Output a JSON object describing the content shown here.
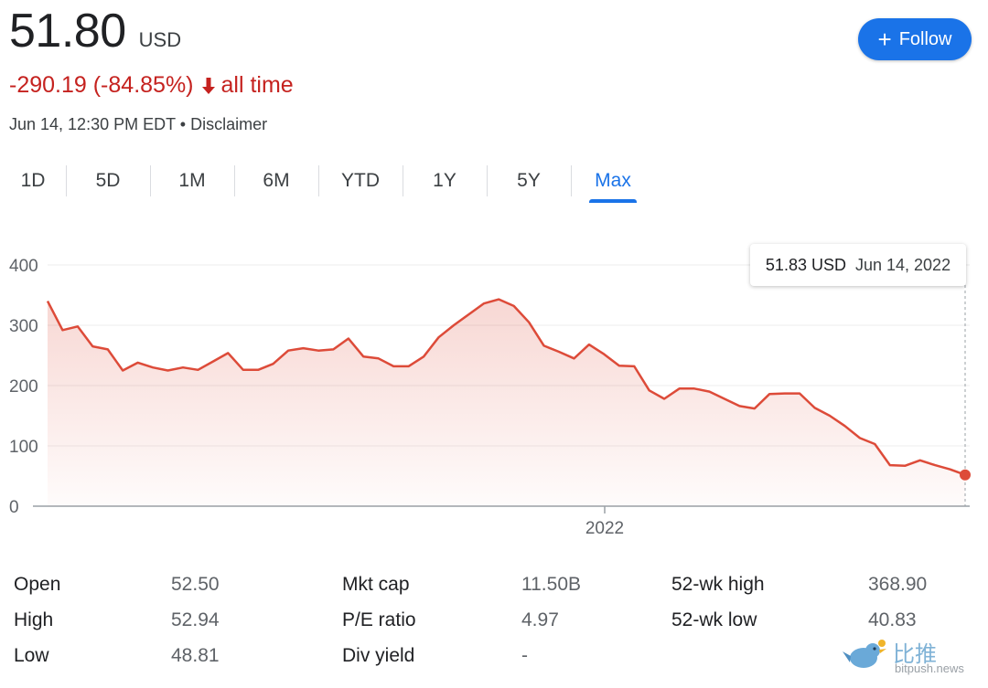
{
  "header": {
    "price": "51.80",
    "currency": "USD",
    "change": "-290.19 (-84.85%)",
    "change_period": "all time",
    "timestamp": "Jun 14, 12:30 PM EDT",
    "separator": " • ",
    "disclaimer": "Disclaimer"
  },
  "follow_button": {
    "icon": "plus-icon",
    "label": "Follow",
    "color": "#1a73e8"
  },
  "tabs": [
    {
      "label": "1D",
      "active": false
    },
    {
      "label": "5D",
      "active": false
    },
    {
      "label": "1M",
      "active": false
    },
    {
      "label": "6M",
      "active": false
    },
    {
      "label": "YTD",
      "active": false
    },
    {
      "label": "1Y",
      "active": false
    },
    {
      "label": "5Y",
      "active": false
    },
    {
      "label": "Max",
      "active": true
    }
  ],
  "tooltip": {
    "value": "51.83 USD",
    "date": "Jun 14, 2022"
  },
  "chart_data": {
    "type": "area",
    "series_color": "#dd4b39",
    "ylim": [
      0,
      400
    ],
    "y_ticks": [
      0,
      100,
      200,
      300,
      400
    ],
    "x_tick_label": "2022",
    "grid": true,
    "values": [
      340,
      292,
      298,
      265,
      260,
      225,
      238,
      230,
      225,
      230,
      226,
      240,
      254,
      226,
      226,
      236,
      258,
      262,
      258,
      260,
      278,
      248,
      245,
      232,
      232,
      248,
      280,
      300,
      318,
      336,
      343,
      332,
      305,
      266,
      256,
      245,
      268,
      252,
      233,
      232,
      192,
      178,
      195,
      195,
      190,
      178,
      166,
      162,
      186,
      187,
      187,
      163,
      150,
      133,
      113,
      103,
      68,
      67,
      76,
      68,
      61,
      52
    ],
    "last_point": 51.83
  },
  "stats": [
    {
      "label": "Open",
      "value": "52.50"
    },
    {
      "label": "High",
      "value": "52.94"
    },
    {
      "label": "Low",
      "value": "48.81"
    },
    {
      "label": "Mkt cap",
      "value": "11.50B"
    },
    {
      "label": "P/E ratio",
      "value": "4.97"
    },
    {
      "label": "Div yield",
      "value": "-"
    },
    {
      "label": "52-wk high",
      "value": "368.90"
    },
    {
      "label": "52-wk low",
      "value": "40.83"
    }
  ],
  "watermark": {
    "text": "比推",
    "sub": "bitpush.news"
  }
}
